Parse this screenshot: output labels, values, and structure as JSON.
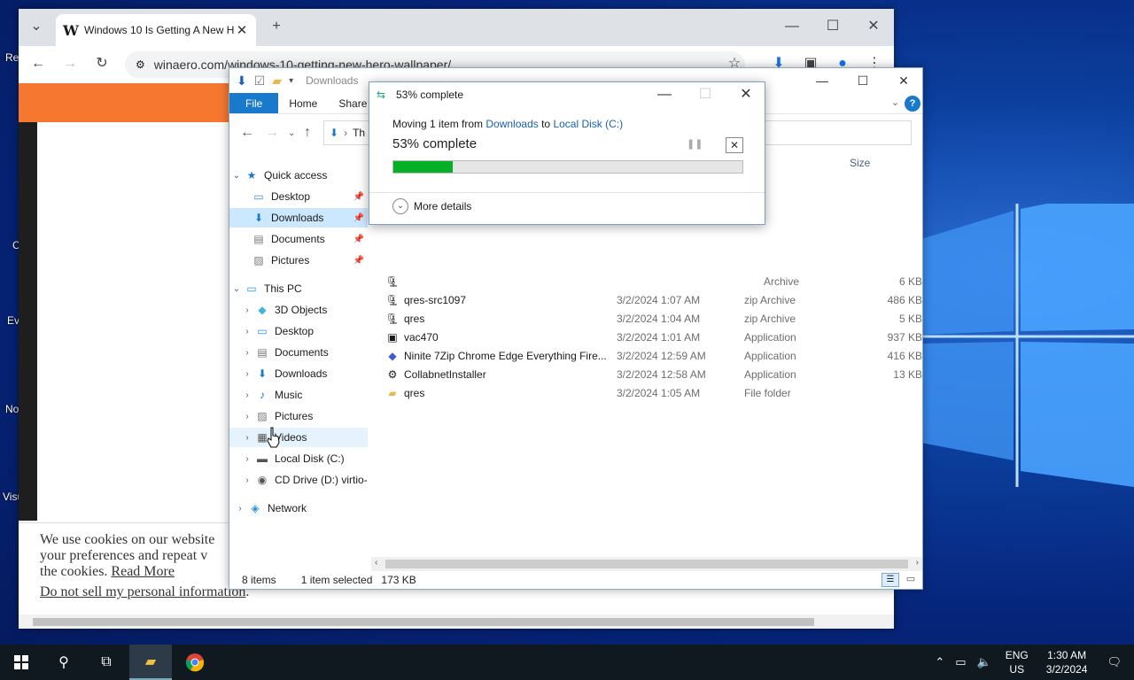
{
  "desktop": {
    "icon_labels": [
      "Re",
      "C",
      "Ev",
      "No",
      "Visu"
    ]
  },
  "chrome": {
    "tab_title": "Windows 10 Is Getting A New H",
    "tab_favicon": "W",
    "url": "winaero.com/windows-10-getting-new-hero-wallpaper/",
    "cookie_line1": "We use cookies on our website",
    "cookie_line2": "your preferences and repeat v",
    "cookie_line3_prefix": "the cookies.",
    "cookie_read_more": "Read More",
    "cookie_line4": "Do not sell my personal information",
    "cookie_line4_suffix": "."
  },
  "explorer": {
    "title": "Downloads",
    "ribbon_tabs": [
      "File",
      "Home",
      "Share"
    ],
    "address_crumb": "Th",
    "column_size": "Size",
    "nav": {
      "quick_access": "Quick access",
      "qa_desktop": "Desktop",
      "qa_downloads": "Downloads",
      "qa_documents": "Documents",
      "qa_pictures": "Pictures",
      "this_pc": "This PC",
      "pc_3d": "3D Objects",
      "pc_desktop": "Desktop",
      "pc_documents": "Documents",
      "pc_downloads": "Downloads",
      "pc_music": "Music",
      "pc_pictures": "Pictures",
      "pc_videos": "Videos",
      "pc_local": "Local Disk (C:)",
      "pc_cd": "CD Drive (D:) virtio-",
      "network": "Network"
    },
    "files": [
      {
        "name": "",
        "date": "",
        "type": "Archive",
        "size": "6 KB",
        "icon": "zip-icon"
      },
      {
        "name": "qres-src1097",
        "date": "3/2/2024 1:07 AM",
        "type": "zip Archive",
        "size": "486 KB",
        "icon": "zip-icon"
      },
      {
        "name": "qres",
        "date": "3/2/2024 1:04 AM",
        "type": "zip Archive",
        "size": "5 KB",
        "icon": "zip-icon"
      },
      {
        "name": "vac470",
        "date": "3/2/2024 1:01 AM",
        "type": "Application",
        "size": "937 KB",
        "icon": "app-icon"
      },
      {
        "name": "Ninite 7Zip Chrome Edge Everything Fire...",
        "date": "3/2/2024 12:59 AM",
        "type": "Application",
        "size": "416 KB",
        "icon": "ninite-icon"
      },
      {
        "name": "CollabnetInstaller",
        "date": "3/2/2024 12:58 AM",
        "type": "Application",
        "size": "13 KB",
        "icon": "installer-icon"
      },
      {
        "name": "qres",
        "date": "3/2/2024 1:05 AM",
        "type": "File folder",
        "size": "",
        "icon": "folder-icon"
      }
    ],
    "status_items": "8 items",
    "status_selected": "1 item selected",
    "status_size": "173 KB"
  },
  "dialog": {
    "title": "53% complete",
    "moving_prefix": "Moving 1 item from",
    "from": "Downloads",
    "to_word": "to",
    "to": "Local Disk (C:)",
    "big_status": "53% complete",
    "progress": 0.17,
    "more_details": "More details",
    "accent": "#06b025"
  },
  "taskbar": {
    "lang": "ENG",
    "region": "US",
    "time": "1:30 AM",
    "date": "3/2/2024"
  }
}
